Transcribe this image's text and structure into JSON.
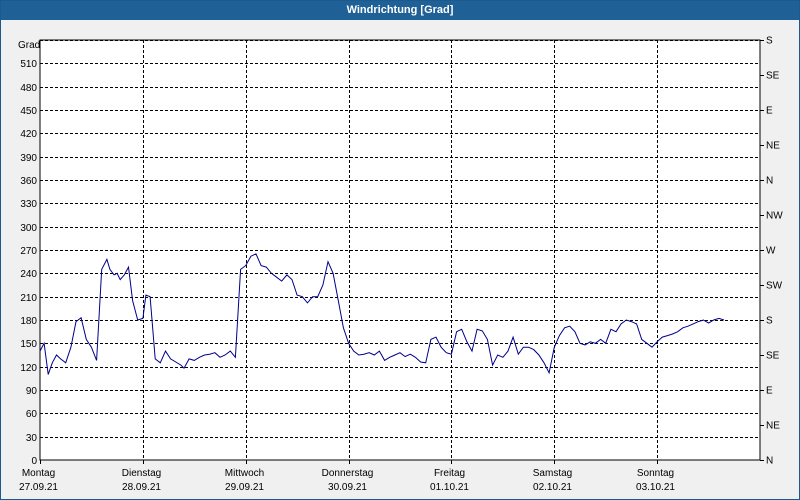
{
  "window": {
    "title": "Windrichtung [Grad]"
  },
  "colors": {
    "line": "#00008b",
    "grid": "#000000",
    "title_bg": "#1f6196",
    "plot_bg": "#ffffff",
    "bg": "#f0f0f0"
  },
  "chart_data": {
    "type": "line",
    "title": "Windrichtung [Grad]",
    "ylabel": "Grad",
    "ylim": [
      0,
      540
    ],
    "yticks": [
      0,
      30,
      60,
      90,
      120,
      150,
      180,
      210,
      240,
      270,
      300,
      330,
      360,
      390,
      420,
      450,
      480,
      510
    ],
    "right_axis": {
      "labels": [
        "N",
        "NE",
        "E",
        "SE",
        "S",
        "SW",
        "W",
        "NW",
        "N",
        "NE",
        "E",
        "SE",
        "S"
      ],
      "values": [
        0,
        45,
        90,
        135,
        180,
        225,
        270,
        315,
        360,
        405,
        450,
        495,
        540
      ]
    },
    "xlim": [
      0,
      7
    ],
    "x_ticks": [
      {
        "x": 0,
        "day": "Montag",
        "date": "27.09.21"
      },
      {
        "x": 1,
        "day": "Dienstag",
        "date": "28.09.21"
      },
      {
        "x": 2,
        "day": "Mittwoch",
        "date": "29.09.21"
      },
      {
        "x": 3,
        "day": "Donnerstag",
        "date": "30.09.21"
      },
      {
        "x": 4,
        "day": "Freitag",
        "date": "01.10.21"
      },
      {
        "x": 5,
        "day": "Samstag",
        "date": "02.10.21"
      },
      {
        "x": 6,
        "day": "Sonntag",
        "date": "03.10.21"
      }
    ],
    "grid": true,
    "series": [
      {
        "x": [
          0,
          0.04,
          0.08,
          0.12,
          0.16,
          0.2,
          0.25,
          0.3,
          0.35,
          0.4,
          0.45,
          0.5,
          0.55,
          0.6,
          0.65,
          0.68,
          0.72,
          0.75,
          0.78,
          0.82,
          0.86,
          0.9,
          0.95,
          1.0,
          1.03,
          1.07,
          1.12,
          1.17,
          1.22,
          1.27,
          1.32,
          1.37,
          1.4,
          1.45,
          1.5,
          1.55,
          1.6,
          1.65,
          1.7,
          1.75,
          1.8,
          1.85,
          1.9,
          1.95,
          2.0,
          2.05,
          2.1,
          2.15,
          2.2,
          2.25,
          2.3,
          2.35,
          2.4,
          2.45,
          2.5,
          2.55,
          2.6,
          2.65,
          2.7,
          2.75,
          2.8,
          2.85,
          2.9,
          2.95,
          3.0,
          3.05,
          3.1,
          3.15,
          3.2,
          3.25,
          3.3,
          3.35,
          3.4,
          3.45,
          3.5,
          3.55,
          3.6,
          3.65,
          3.7,
          3.75,
          3.8,
          3.85,
          3.9,
          3.95,
          4.0,
          4.05,
          4.1,
          4.15,
          4.2,
          4.25,
          4.3,
          4.35,
          4.4,
          4.45,
          4.5,
          4.55,
          4.6,
          4.65,
          4.7,
          4.75,
          4.8,
          4.85,
          4.9,
          4.95,
          5.0,
          5.05,
          5.1,
          5.15,
          5.2,
          5.25,
          5.3,
          5.35,
          5.4,
          5.45,
          5.5,
          5.55,
          5.6,
          5.65,
          5.7,
          5.75,
          5.8,
          5.85,
          5.9,
          5.95,
          6.0,
          6.05,
          6.1,
          6.15,
          6.2,
          6.25,
          6.3,
          6.35,
          6.4,
          6.45,
          6.5,
          6.55,
          6.6,
          6.65
        ],
        "values": [
          140,
          150,
          110,
          125,
          135,
          130,
          125,
          145,
          178,
          183,
          155,
          145,
          128,
          245,
          258,
          245,
          238,
          240,
          232,
          238,
          248,
          205,
          180,
          182,
          212,
          210,
          130,
          125,
          140,
          130,
          126,
          122,
          118,
          130,
          128,
          132,
          135,
          136,
          138,
          132,
          135,
          140,
          132,
          245,
          250,
          262,
          265,
          250,
          248,
          240,
          235,
          230,
          238,
          232,
          212,
          210,
          202,
          210,
          210,
          225,
          255,
          240,
          205,
          170,
          150,
          140,
          135,
          136,
          138,
          135,
          140,
          128,
          132,
          135,
          138,
          133,
          136,
          132,
          126,
          125,
          155,
          158,
          145,
          138,
          136,
          165,
          168,
          152,
          140,
          168,
          166,
          155,
          122,
          135,
          132,
          140,
          158,
          136,
          145,
          145,
          142,
          135,
          125,
          112,
          145,
          160,
          170,
          172,
          165,
          150,
          148,
          152,
          150,
          155,
          150,
          168,
          165,
          175,
          180,
          178,
          175,
          155,
          150,
          145,
          152,
          158,
          160,
          162,
          165,
          170,
          172,
          175,
          178,
          180,
          176,
          180,
          182,
          180
        ]
      }
    ]
  }
}
